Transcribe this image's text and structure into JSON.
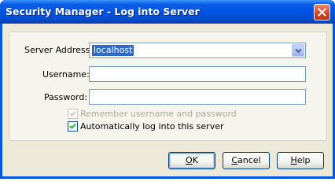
{
  "window": {
    "title": "Security Manager - Log into Server"
  },
  "form": {
    "server_label": "Server Address:",
    "server_value": "localhost",
    "username_label": "Username:",
    "username_value": "",
    "password_label": "Password:",
    "password_value": "",
    "remember_label": "Remember username and password",
    "remember_checked": true,
    "remember_enabled": false,
    "autologin_label": "Automatically log into this server",
    "autologin_checked": true
  },
  "buttons": {
    "ok": {
      "mnemonic": "O",
      "rest": "K"
    },
    "cancel": {
      "mnemonic": "C",
      "rest": "ancel"
    },
    "help": {
      "mnemonic": "H",
      "rest": "elp"
    }
  },
  "icons": {
    "close": "close-icon",
    "dropdown": "chevron-down-icon",
    "check": "checkmark-icon"
  },
  "colors": {
    "titlebar": "#0054e3",
    "dialog_bg": "#ece9d8",
    "selection": "#316ac5",
    "close_button": "#c8452a"
  }
}
